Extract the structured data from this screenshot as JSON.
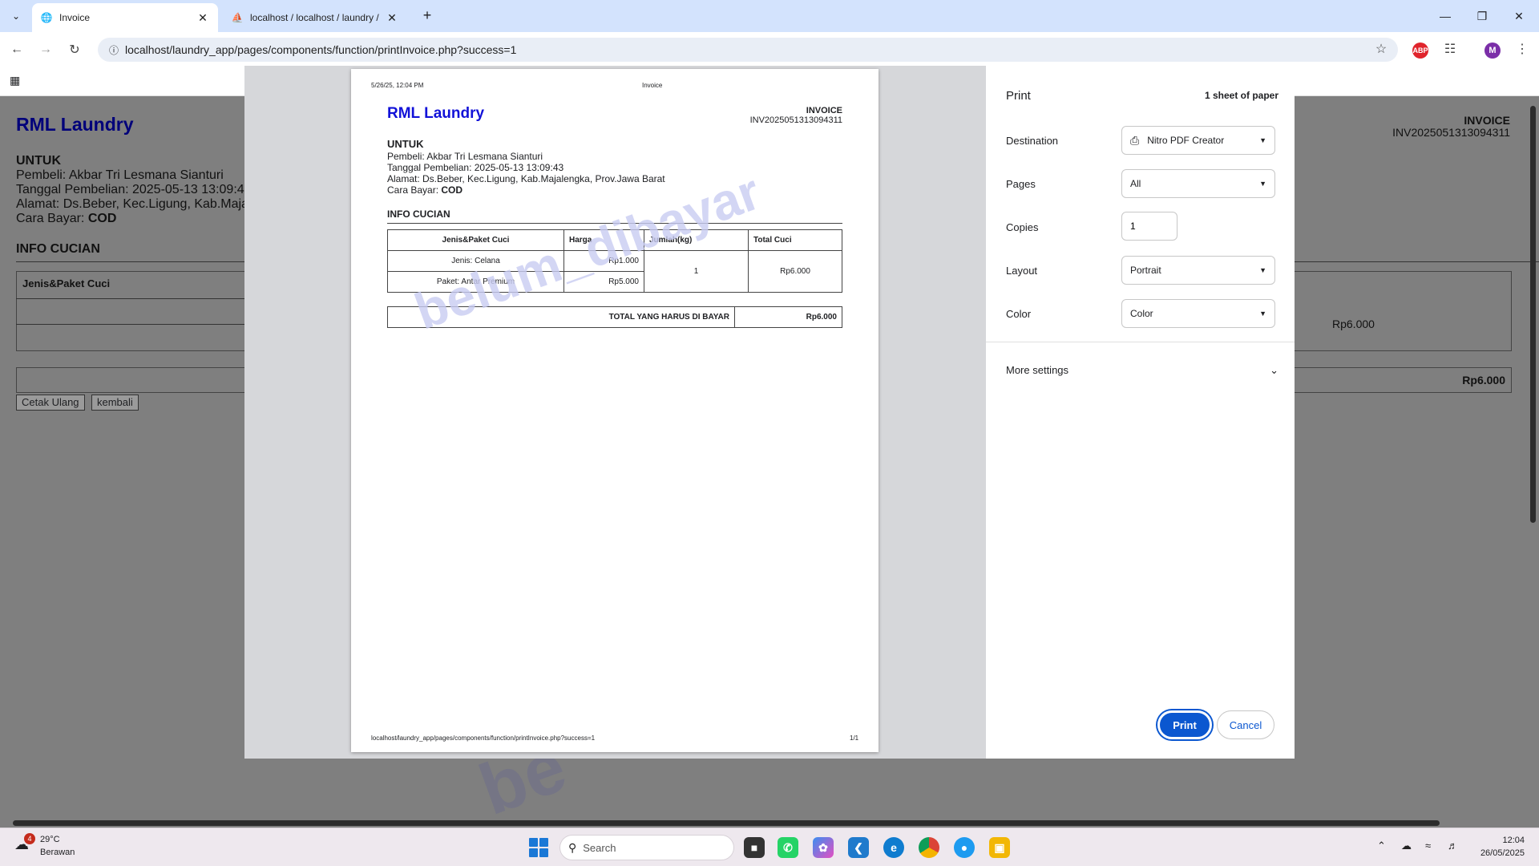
{
  "browser": {
    "tabs": [
      {
        "title": "Invoice",
        "active": true
      },
      {
        "title": "localhost / localhost / laundry /",
        "active": false
      }
    ],
    "url": "localhost/laundry_app/pages/components/function/printInvoice.php?success=1"
  },
  "background_page": {
    "brand": "RML Laundry",
    "untuk": "UNTUK",
    "buyer": "Pembeli: Akbar Tri Lesmana Sianturi",
    "date": "Tanggal Pembelian: 2025-05-13 13:09:4",
    "address": "Alamat: Ds.Beber, Kec.Ligung, Kab.Maja",
    "payment_label": "Cara Bayar:",
    "payment_value": "COD",
    "section": "INFO CUCIAN",
    "col_header": "Jenis&Paket Cuci",
    "invoice_label": "INVOICE",
    "invoice_number": "INV2025051313094311",
    "total_cuci": "Rp6.000",
    "grand_total": "Rp6.000",
    "btn_reprint": "Cetak Ulang",
    "btn_back": "kembali"
  },
  "preview": {
    "header_left": "5/26/25, 12:04 PM",
    "header_center": "Invoice",
    "footer_left": "localhost/laundry_app/pages/components/function/printInvoice.php?success=1",
    "footer_right": "1/1",
    "brand": "RML Laundry",
    "invoice_label": "INVOICE",
    "invoice_number": "INV2025051313094311",
    "untuk": "UNTUK",
    "buyer": "Pembeli: Akbar Tri Lesmana Sianturi",
    "date": "Tanggal Pembelian: 2025-05-13 13:09:43",
    "address": "Alamat: Ds.Beber, Kec.Ligung, Kab.Majalengka, Prov.Jawa Barat",
    "payment_label": "Cara Bayar:",
    "payment_value": "COD",
    "section": "INFO CUCIAN",
    "table_headers": [
      "Jenis&Paket Cuci",
      "Harga",
      "Jumlah(kg)",
      "Total Cuci"
    ],
    "rows": [
      {
        "item": "Jenis: Celana",
        "price": "Rp1.000"
      },
      {
        "item": "Paket: Antar Premium",
        "price": "Rp5.000"
      }
    ],
    "quantity": "1",
    "total_cuci": "Rp6.000",
    "total_label": "TOTAL YANG HARUS DI BAYAR",
    "total_value": "Rp6.000",
    "watermark": "belum_dibayar"
  },
  "print_settings": {
    "title": "Print",
    "sheets": "1 sheet of paper",
    "destination_label": "Destination",
    "destination_value": "Nitro PDF Creator",
    "pages_label": "Pages",
    "pages_value": "All",
    "copies_label": "Copies",
    "copies_value": "1",
    "layout_label": "Layout",
    "layout_value": "Portrait",
    "color_label": "Color",
    "color_value": "Color",
    "more_settings": "More settings",
    "print_button": "Print",
    "cancel_button": "Cancel"
  },
  "taskbar": {
    "weather_badge": "4",
    "temperature": "29°C",
    "condition": "Berawan",
    "search_placeholder": "Search",
    "time": "12:04",
    "date": "26/05/2025"
  },
  "colors": {
    "accent": "#0b57d0",
    "brand": "#1212d8",
    "tabstrip": "#d3e3fd"
  }
}
